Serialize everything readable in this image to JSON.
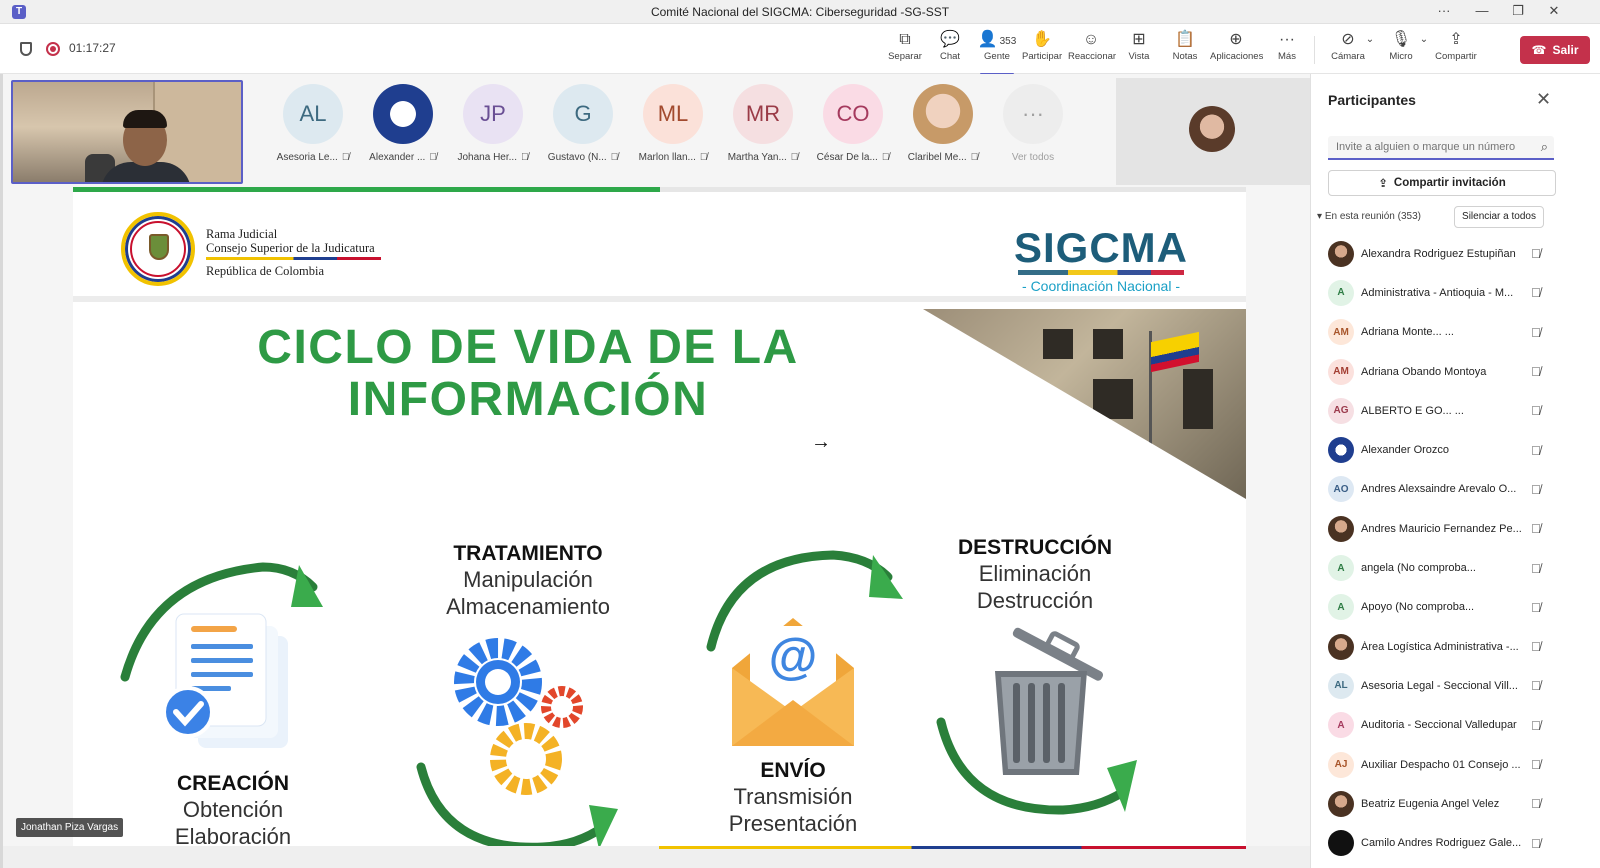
{
  "window": {
    "title": "Comité Nacional del SIGCMA: Ciberseguridad -SG-SST",
    "controls": [
      "···",
      "—",
      "❐",
      "✕"
    ]
  },
  "toolbar": {
    "timer": "01:17:27",
    "buttons": [
      {
        "label": "Separar",
        "icon": "detach-icon",
        "glyph": "⧉"
      },
      {
        "label": "Chat",
        "icon": "chat-icon",
        "glyph": "💬"
      },
      {
        "label": "Gente",
        "icon": "people-icon",
        "glyph": "👤",
        "count": "353"
      },
      {
        "label": "Participar",
        "icon": "raise-hand-icon",
        "glyph": "✋"
      },
      {
        "label": "Reaccionar",
        "icon": "emoji-icon",
        "glyph": "☺"
      },
      {
        "label": "Vista",
        "icon": "view-grid-icon",
        "glyph": "⊞"
      },
      {
        "label": "Notas",
        "icon": "notes-icon",
        "glyph": "📋"
      },
      {
        "label": "Aplicaciones",
        "icon": "apps-add-icon",
        "glyph": "⊕"
      },
      {
        "label": "Más",
        "icon": "more-icon",
        "glyph": "···"
      },
      {
        "label": "Cámara",
        "icon": "camera-off-icon",
        "glyph": "⊘"
      },
      {
        "label": "Micro",
        "icon": "mic-off-icon",
        "glyph": "🎙"
      },
      {
        "label": "Compartir",
        "icon": "share-screen-icon",
        "glyph": "⇪"
      }
    ],
    "leave_label": "Salir"
  },
  "strip": {
    "participants": [
      {
        "initials": "AL",
        "name": "Asesoria Le...",
        "bg": "#dde9f0",
        "fg": "#3d6a80"
      },
      {
        "initials": "",
        "name": "Alexander ...",
        "bg": "#1f3e8f",
        "fg": "#ffffff"
      },
      {
        "initials": "JP",
        "name": "Johana Her...",
        "bg": "#e9e2f3",
        "fg": "#6a4f94"
      },
      {
        "initials": "G",
        "name": "Gustavo (N...",
        "bg": "#dde9f0",
        "fg": "#3d6a80"
      },
      {
        "initials": "ML",
        "name": "Marlon llan...",
        "bg": "#fbe1d9",
        "fg": "#a24a2e"
      },
      {
        "initials": "MR",
        "name": "Martha Yan...",
        "bg": "#f5dfe1",
        "fg": "#9a3b47"
      },
      {
        "initials": "CO",
        "name": "César De la...",
        "bg": "#fadbe5",
        "fg": "#a53a5e"
      },
      {
        "initials": "",
        "name": "Claribel Me...",
        "bg": "#e6c9a8",
        "fg": "#5a3b2a"
      }
    ],
    "see_all_label": "Ver todos"
  },
  "slide": {
    "org_lines": [
      "Rama Judicial",
      "Consejo Superior de la Judicatura",
      "República de Colombia"
    ],
    "brand": "SIGCMA",
    "brand_sub": "- Coordinación Nacional -",
    "title_line1": "CICLO DE VIDA DE LA",
    "title_line2": "INFORMACIÓN",
    "stages": {
      "creacion": {
        "heading": "CREACIÓN",
        "lines": [
          "Obtención",
          "Elaboración"
        ]
      },
      "tratamiento": {
        "heading": "TRATAMIENTO",
        "lines": [
          "Manipulación",
          "Almacenamiento"
        ]
      },
      "envio": {
        "heading": "ENVÍO",
        "lines": [
          "Transmisión",
          "Presentación"
        ]
      },
      "destruccion": {
        "heading": "DESTRUCCIÓN",
        "lines": [
          "Eliminación",
          "Destrucción"
        ]
      }
    },
    "email_symbol": "@"
  },
  "presenter_name": "Jonathan Piza Vargas",
  "sidebar": {
    "title": "Participantes",
    "invite_placeholder": "Invite a alguien o marque un número",
    "share_invite": "Compartir invitación",
    "in_meeting": "En esta reunión (353)",
    "mute_all": "Silenciar a todos",
    "people": [
      {
        "initials": "",
        "name": "Alexandra Rodriguez Estupiñan",
        "bg": "photo",
        "fg": "#fff"
      },
      {
        "initials": "A",
        "name": "Administrativa - Antioquia - M...",
        "bg": "#e1f3e6",
        "fg": "#2e7d45"
      },
      {
        "initials": "AM",
        "name": "Adriana Monte... ...",
        "bg": "#fde7d9",
        "fg": "#a8552a"
      },
      {
        "initials": "AM",
        "name": "Adriana Obando Montoya",
        "bg": "#fbe1dd",
        "fg": "#a33e33"
      },
      {
        "initials": "AG",
        "name": "ALBERTO E GO... ...",
        "bg": "#f6dfe3",
        "fg": "#9b3a4c"
      },
      {
        "initials": "",
        "name": "Alexander Orozco",
        "bg": "#1f3e8f",
        "fg": "#fff"
      },
      {
        "initials": "AO",
        "name": "Andres Alexsaindre Arevalo O...",
        "bg": "#dde8f3",
        "fg": "#3a5e86"
      },
      {
        "initials": "",
        "name": "Andres Mauricio Fernandez Pe...",
        "bg": "photo",
        "fg": "#fff"
      },
      {
        "initials": "A",
        "name": "angela (No comproba...",
        "bg": "#e1f3e6",
        "fg": "#2e7d45"
      },
      {
        "initials": "A",
        "name": "Apoyo (No comproba...",
        "bg": "#e1f3e6",
        "fg": "#2e7d45"
      },
      {
        "initials": "",
        "name": "Área Logística Administrativa -...",
        "bg": "photo",
        "fg": "#fff"
      },
      {
        "initials": "AL",
        "name": "Asesoria Legal - Seccional Vill...",
        "bg": "#dde9f0",
        "fg": "#3d6a80"
      },
      {
        "initials": "A",
        "name": "Auditoria - Seccional Valledupar",
        "bg": "#fadbe5",
        "fg": "#a53a5e"
      },
      {
        "initials": "AJ",
        "name": "Auxiliar Despacho 01 Consejo ...",
        "bg": "#fde7d9",
        "fg": "#a8552a"
      },
      {
        "initials": "",
        "name": "Beatriz Eugenia Angel Velez",
        "bg": "photo",
        "fg": "#fff"
      },
      {
        "initials": "",
        "name": "Camilo Andres Rodriguez Gale...",
        "bg": "#111111",
        "fg": "#fff"
      }
    ]
  }
}
